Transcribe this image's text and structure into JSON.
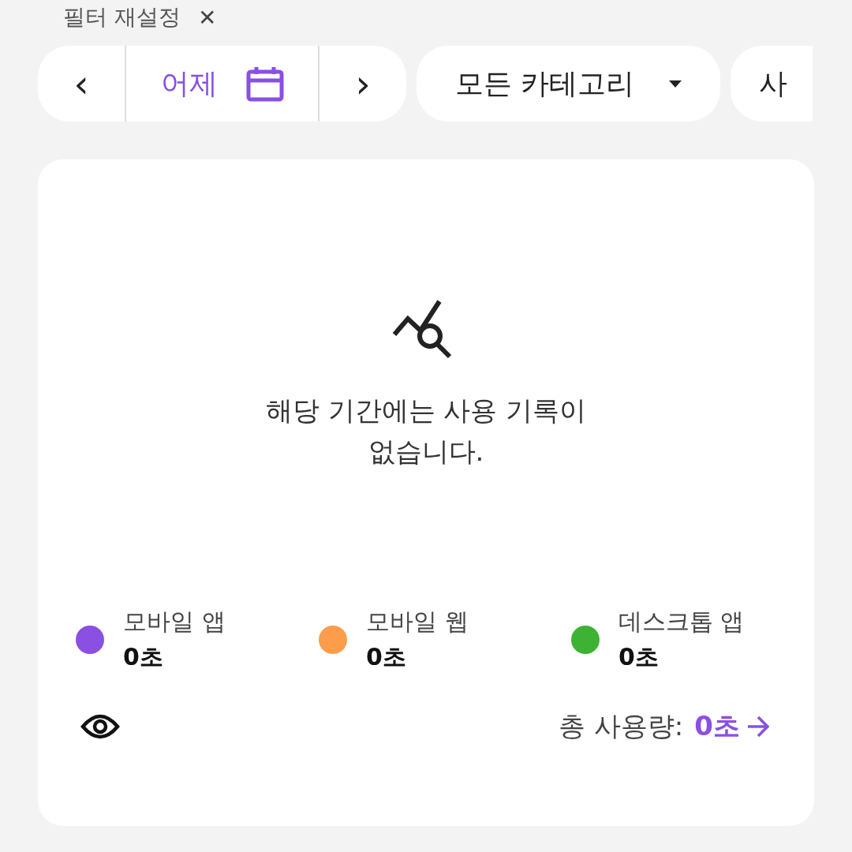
{
  "filter_reset": {
    "label": "필터 재설정",
    "close": "✕"
  },
  "date_nav": {
    "prev": "‹",
    "label": "어제",
    "next": "›"
  },
  "category": {
    "label": "모든 카테고리"
  },
  "third_filter": {
    "label": "사"
  },
  "empty_state": {
    "message": "해당 기간에는 사용 기록이 없습니다."
  },
  "legend": [
    {
      "name": "모바일 앱",
      "value": "0초",
      "color": "#8a4fe3"
    },
    {
      "name": "모바일 웹",
      "value": "0초",
      "color": "#fd9d4b"
    },
    {
      "name": "데스크톱 앱",
      "value": "0초",
      "color": "#3db234"
    }
  ],
  "total": {
    "label": "총 사용량:",
    "value": "0초"
  }
}
